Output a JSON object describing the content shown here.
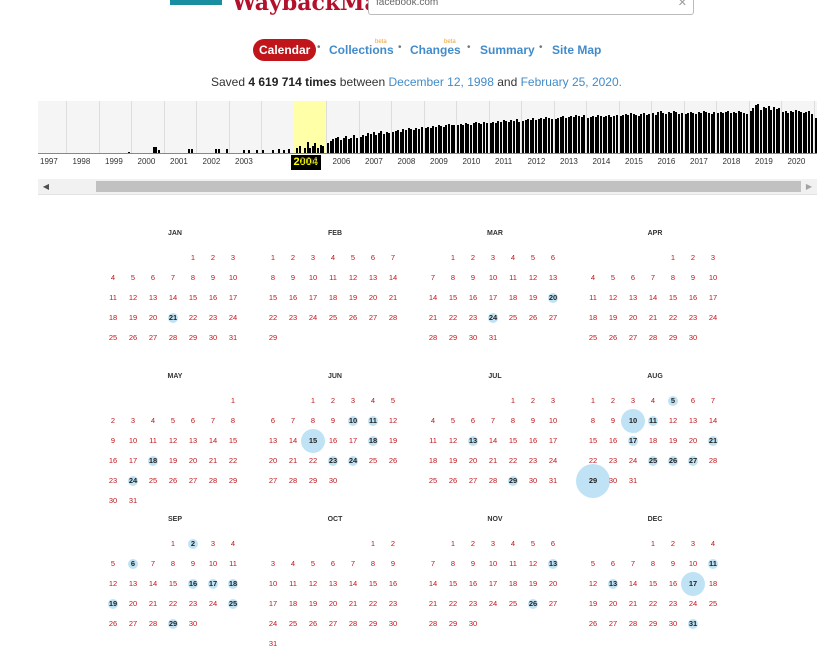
{
  "header": {
    "logo_text": "WaybackMachine",
    "url_value": "facebook.com",
    "clear_icon": "x-icon"
  },
  "nav": {
    "calendar": "Calendar",
    "collections": "Collections",
    "changes": "Changes",
    "summary": "Summary",
    "site_map": "Site Map",
    "beta": "beta"
  },
  "saved": {
    "prefix": "Saved ",
    "count": "4 619 714 times",
    "between": " between ",
    "start": "December 12, 1998",
    "and": " and ",
    "end": "February 25, 2020."
  },
  "timeline": {
    "years": [
      "1997",
      "1998",
      "1999",
      "2000",
      "2001",
      "2002",
      "2003",
      "2004",
      "2005",
      "2006",
      "2007",
      "2008",
      "2009",
      "2010",
      "2011",
      "2012",
      "2013",
      "2014",
      "2015",
      "2016",
      "2017",
      "2018",
      "2019",
      "2020"
    ],
    "selected_year": "2004",
    "selected_color": "#ffffa8",
    "bar_color": "#000000",
    "monthly_levels": [
      [
        0,
        0,
        0,
        0,
        0,
        0,
        0,
        0,
        0,
        0,
        0,
        0
      ],
      [
        0,
        0,
        0,
        0,
        0,
        0,
        0,
        0,
        0,
        0,
        0,
        0.02
      ],
      [
        0,
        0,
        0,
        0,
        0,
        0,
        0,
        0,
        0.12,
        0.12,
        0.06,
        0
      ],
      [
        0,
        0,
        0,
        0,
        0,
        0,
        0,
        0,
        0,
        0.07,
        0.07,
        0
      ],
      [
        0,
        0,
        0,
        0,
        0,
        0,
        0,
        0.07,
        0.07,
        0,
        0,
        0.07
      ],
      [
        0,
        0,
        0,
        0,
        0,
        0.06,
        0,
        0.06,
        0,
        0,
        0.06,
        0
      ],
      [
        0.06,
        0,
        0,
        0,
        0.06,
        0,
        0.08,
        0,
        0.06,
        0,
        0.08,
        0
      ],
      [
        0,
        0.1,
        0.14,
        0,
        0.1,
        0.22,
        0.1,
        0.14,
        0.2,
        0.1,
        0.16,
        0.14
      ],
      [
        0.2,
        0.24,
        0.28,
        0.3,
        0.32,
        0.26,
        0.3,
        0.34,
        0.28,
        0.3,
        0.35,
        0.3
      ],
      [
        0.32,
        0.36,
        0.34,
        0.4,
        0.38,
        0.42,
        0.36,
        0.4,
        0.44,
        0.38,
        0.42,
        0.4
      ],
      [
        0.42,
        0.44,
        0.46,
        0.42,
        0.48,
        0.46,
        0.5,
        0.48,
        0.46,
        0.5,
        0.48,
        0.52
      ],
      [
        0.5,
        0.52,
        0.5,
        0.54,
        0.52,
        0.56,
        0.54,
        0.52,
        0.56,
        0.58,
        0.55,
        0.57
      ],
      [
        0.56,
        0.58,
        0.57,
        0.6,
        0.58,
        0.56,
        0.6,
        0.62,
        0.6,
        0.58,
        0.62,
        0.6
      ],
      [
        0.6,
        0.62,
        0.6,
        0.64,
        0.62,
        0.66,
        0.64,
        0.62,
        0.66,
        0.64,
        0.68,
        0.62
      ],
      [
        0.64,
        0.66,
        0.68,
        0.66,
        0.7,
        0.66,
        0.68,
        0.7,
        0.68,
        0.72,
        0.7,
        0.68
      ],
      [
        0.68,
        0.7,
        0.72,
        0.74,
        0.7,
        0.72,
        0.74,
        0.72,
        0.76,
        0.74,
        0.72,
        0.76
      ],
      [
        0.7,
        0.72,
        0.74,
        0.72,
        0.76,
        0.74,
        0.72,
        0.74,
        0.76,
        0.72,
        0.74,
        0.76
      ],
      [
        0.74,
        0.76,
        0.78,
        0.76,
        0.8,
        0.78,
        0.76,
        0.74,
        0.78,
        0.8,
        0.76,
        0.78
      ],
      [
        0.8,
        0.76,
        0.82,
        0.84,
        0.8,
        0.78,
        0.82,
        0.8,
        0.84,
        0.82,
        0.78,
        0.8
      ],
      [
        0.78,
        0.8,
        0.82,
        0.8,
        0.78,
        0.82,
        0.8,
        0.84,
        0.82,
        0.8,
        0.78,
        0.82
      ],
      [
        0.8,
        0.82,
        0.8,
        0.82,
        0.84,
        0.8,
        0.82,
        0.8,
        0.84,
        0.82,
        0.8,
        0.78
      ],
      [
        0.84,
        0.9,
        0.96,
        0.98,
        0.86,
        0.92,
        0.9,
        0.94,
        0.86,
        0.92,
        0.88,
        0.9
      ],
      [
        0.82,
        0.84,
        0.8,
        0.84,
        0.82,
        0.86,
        0.84,
        0.82,
        0.8,
        0.82,
        0.84,
        0.78
      ],
      [
        0.7,
        0,
        0,
        0,
        0,
        0,
        0,
        0,
        0,
        0,
        0,
        0
      ]
    ]
  },
  "calendar": {
    "year": 2004,
    "months": [
      {
        "name": "JAN",
        "start": 4,
        "days": 31,
        "captures": {
          "21": 1
        }
      },
      {
        "name": "FEB",
        "start": 0,
        "days": 29,
        "captures": {}
      },
      {
        "name": "MAR",
        "start": 1,
        "days": 31,
        "captures": {
          "20": 1,
          "24": 1
        }
      },
      {
        "name": "APR",
        "start": 4,
        "days": 30,
        "captures": {}
      },
      {
        "name": "MAY",
        "start": 6,
        "days": 31,
        "captures": {
          "18": 1,
          "24": 1
        }
      },
      {
        "name": "JUN",
        "start": 2,
        "days": 30,
        "captures": {
          "10": 1,
          "11": 1,
          "15": 2,
          "18": 1,
          "23": 1,
          "24": 1
        }
      },
      {
        "name": "JUL",
        "start": 4,
        "days": 31,
        "captures": {
          "13": 1,
          "29": 1
        }
      },
      {
        "name": "AUG",
        "start": 0,
        "days": 31,
        "captures": {
          "5": 1,
          "10": 2,
          "11": 1,
          "17": 1,
          "21": 1,
          "25": 1,
          "26": 1,
          "27": 1,
          "29": 3
        }
      },
      {
        "name": "SEP",
        "start": 3,
        "days": 30,
        "captures": {
          "2": 1,
          "6": 1,
          "16": 1,
          "17": 1,
          "18": 1,
          "19": 1,
          "25": 1,
          "29": 1
        }
      },
      {
        "name": "OCT",
        "start": 5,
        "days": 31,
        "captures": {}
      },
      {
        "name": "NOV",
        "start": 1,
        "days": 30,
        "captures": {
          "13": 1,
          "26": 1
        }
      },
      {
        "name": "DEC",
        "start": 3,
        "days": 31,
        "captures": {
          "11": 1,
          "13": 1,
          "17": 2,
          "31": 1
        }
      }
    ],
    "capture_color": "#bfe3f5",
    "empty_day_color": "#c0151b"
  },
  "scrollbar": {
    "left_arrow": "arrow-left-icon",
    "right_arrow": "arrow-right-icon"
  }
}
